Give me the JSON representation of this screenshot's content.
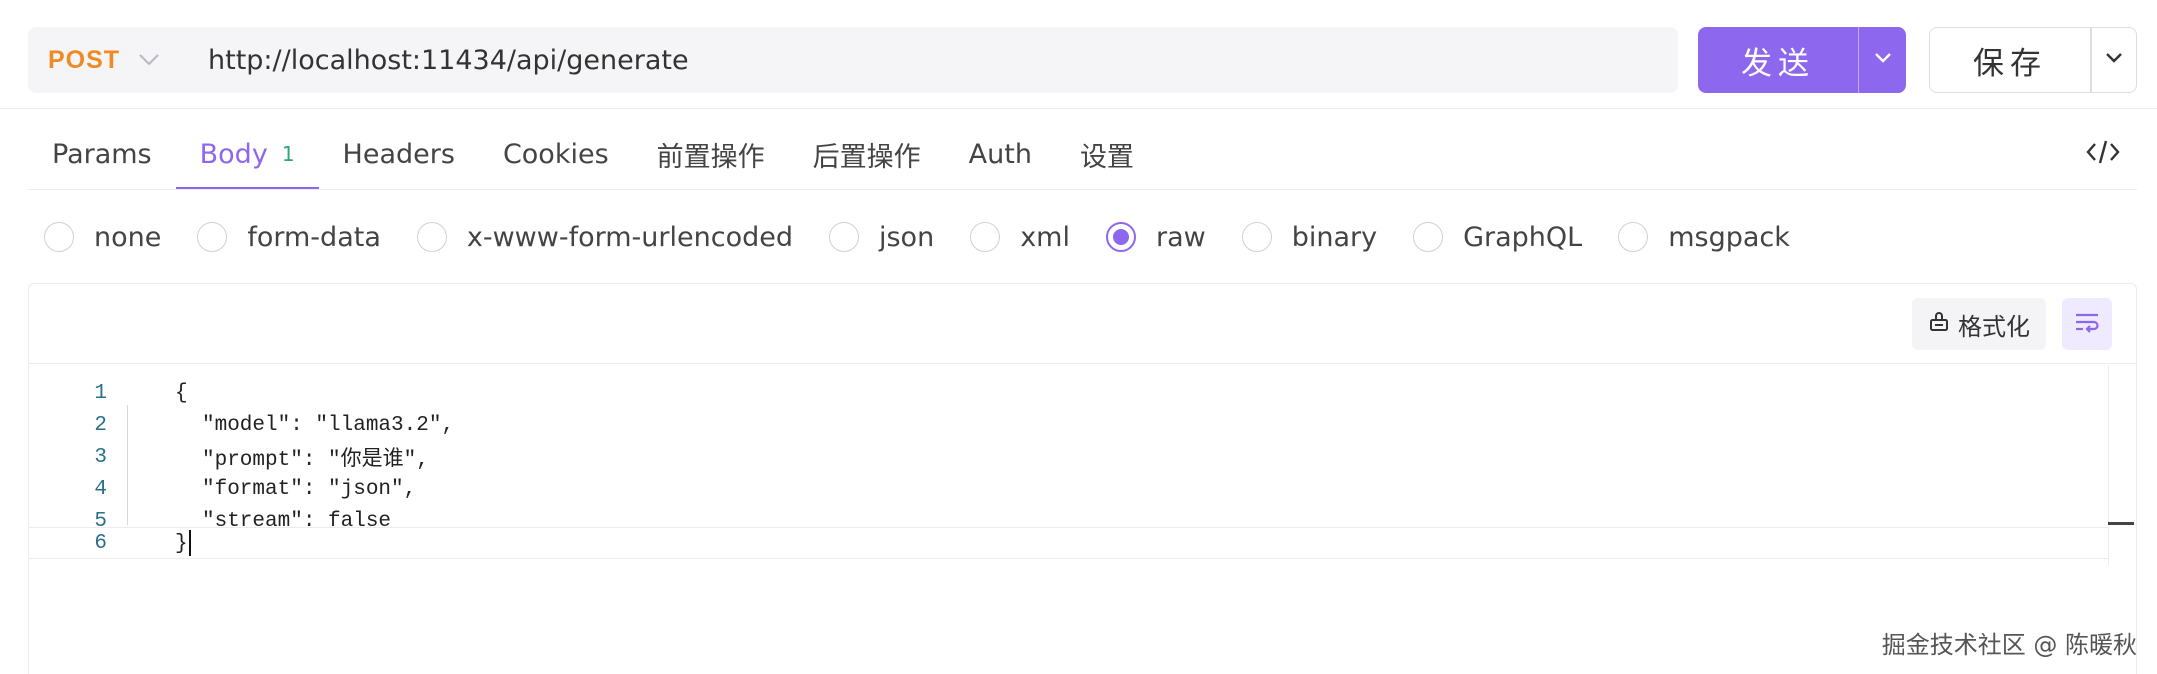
{
  "request": {
    "method": "POST",
    "url": "http://localhost:11434/api/generate",
    "send_label": "发送",
    "save_label": "保存"
  },
  "tabs": [
    {
      "label": "Params",
      "active": false
    },
    {
      "label": "Body",
      "active": true,
      "badge": "1"
    },
    {
      "label": "Headers",
      "active": false
    },
    {
      "label": "Cookies",
      "active": false
    },
    {
      "label": "前置操作",
      "active": false
    },
    {
      "label": "后置操作",
      "active": false
    },
    {
      "label": "Auth",
      "active": false
    },
    {
      "label": "设置",
      "active": false
    }
  ],
  "body_types": [
    {
      "label": "none",
      "checked": false
    },
    {
      "label": "form-data",
      "checked": false
    },
    {
      "label": "x-www-form-urlencoded",
      "checked": false
    },
    {
      "label": "json",
      "checked": false
    },
    {
      "label": "xml",
      "checked": false
    },
    {
      "label": "raw",
      "checked": true
    },
    {
      "label": "binary",
      "checked": false
    },
    {
      "label": "GraphQL",
      "checked": false
    },
    {
      "label": "msgpack",
      "checked": false
    }
  ],
  "editor": {
    "format_label": "格式化",
    "lines": [
      {
        "num": "1",
        "text": "{"
      },
      {
        "num": "2",
        "text": "\"model\": \"llama3.2\","
      },
      {
        "num": "3",
        "text": "\"prompt\": \"你是谁\","
      },
      {
        "num": "4",
        "text": "\"format\": \"json\","
      },
      {
        "num": "5",
        "text": "\"stream\": false"
      },
      {
        "num": "6",
        "text": "}"
      }
    ]
  },
  "watermark": "掘金技术社区 @ 陈暖秋",
  "colors": {
    "accent": "#8d67ee",
    "method": "#f08a24",
    "badge": "#2aa876",
    "line_numbers": "#2a6f8c"
  },
  "icons": [
    "chevron-down-icon",
    "code-icon",
    "format-icon",
    "wrap-icon"
  ]
}
